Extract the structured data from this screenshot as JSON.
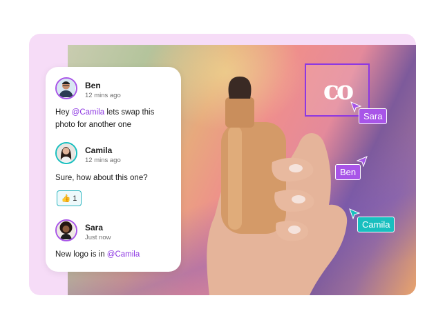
{
  "chat": {
    "messages": [
      {
        "author": "Ben",
        "time": "12 mins ago",
        "text_before": "Hey ",
        "mention": "@Camila",
        "text_after": " lets swap this photo for another one",
        "avatar_border": "#a855e8"
      },
      {
        "author": "Camila",
        "time": "12 mins ago",
        "text": "Sure, how about this one?",
        "reaction": {
          "emoji": "👍",
          "count": "1"
        },
        "avatar_border": "#18bfbf"
      },
      {
        "author": "Sara",
        "time": "Just now",
        "text_before": "New logo is in ",
        "mention": "@Camila",
        "avatar_border": "#a855e8"
      }
    ]
  },
  "canvas": {
    "logo_text": "co",
    "cursors": [
      {
        "label": "Sara",
        "color": "#a855e8"
      },
      {
        "label": "Ben",
        "color": "#a855e8"
      },
      {
        "label": "Camila",
        "color": "#18bfbf"
      }
    ]
  },
  "colors": {
    "accent_purple": "#8d37e2",
    "accent_teal": "#18bfbf",
    "frame_bg": "#f6dcf7"
  }
}
